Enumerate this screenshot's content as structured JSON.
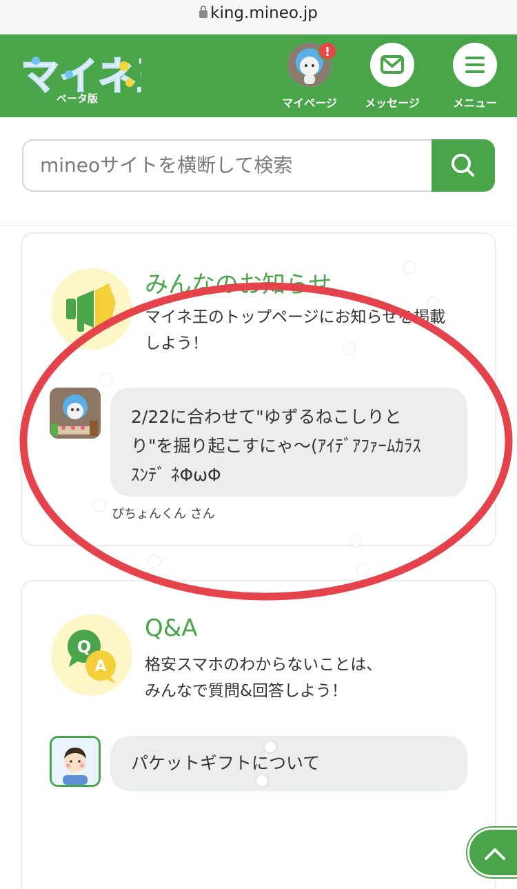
{
  "browser": {
    "url": "king.mineo.jp"
  },
  "header": {
    "logo_text": "マイネ王",
    "logo_sub": "ベータ版",
    "badge": "!",
    "nav": [
      {
        "label": "マイページ",
        "icon": "avatar-icon"
      },
      {
        "label": "メッセージ",
        "icon": "envelope-icon"
      },
      {
        "label": "メニュー",
        "icon": "hamburger-icon"
      }
    ]
  },
  "search": {
    "placeholder": "mineoサイトを横断して検索",
    "icon": "search-icon"
  },
  "notice": {
    "title": "みんなのお知らせ",
    "desc_line1": "マイネ王のトップページにお知らせを掲載",
    "desc_line2": "しよう！",
    "post_line1": "2/22に合わせて\"ゆずるねこしりと",
    "post_line2": "り\"を掘り起こすにゃ〜(ｱｲﾃﾞｱﾌｧｰﾑｶﾗｽ",
    "post_line3": "ｽﾝﾃﾞ ﾈΦωΦ",
    "author": "ぴちょんくん さん"
  },
  "qa": {
    "title": "Q&A",
    "desc_line1": "格安スマホのわからないことは、",
    "desc_line2": "みんなで質問&回答しよう！",
    "post": "パケットギフトについて",
    "icon_q": "Q",
    "icon_a": "A"
  },
  "colors": {
    "brand_green": "#4aa54a",
    "annotation_red": "#e5434b",
    "badge_red": "#e74646"
  }
}
